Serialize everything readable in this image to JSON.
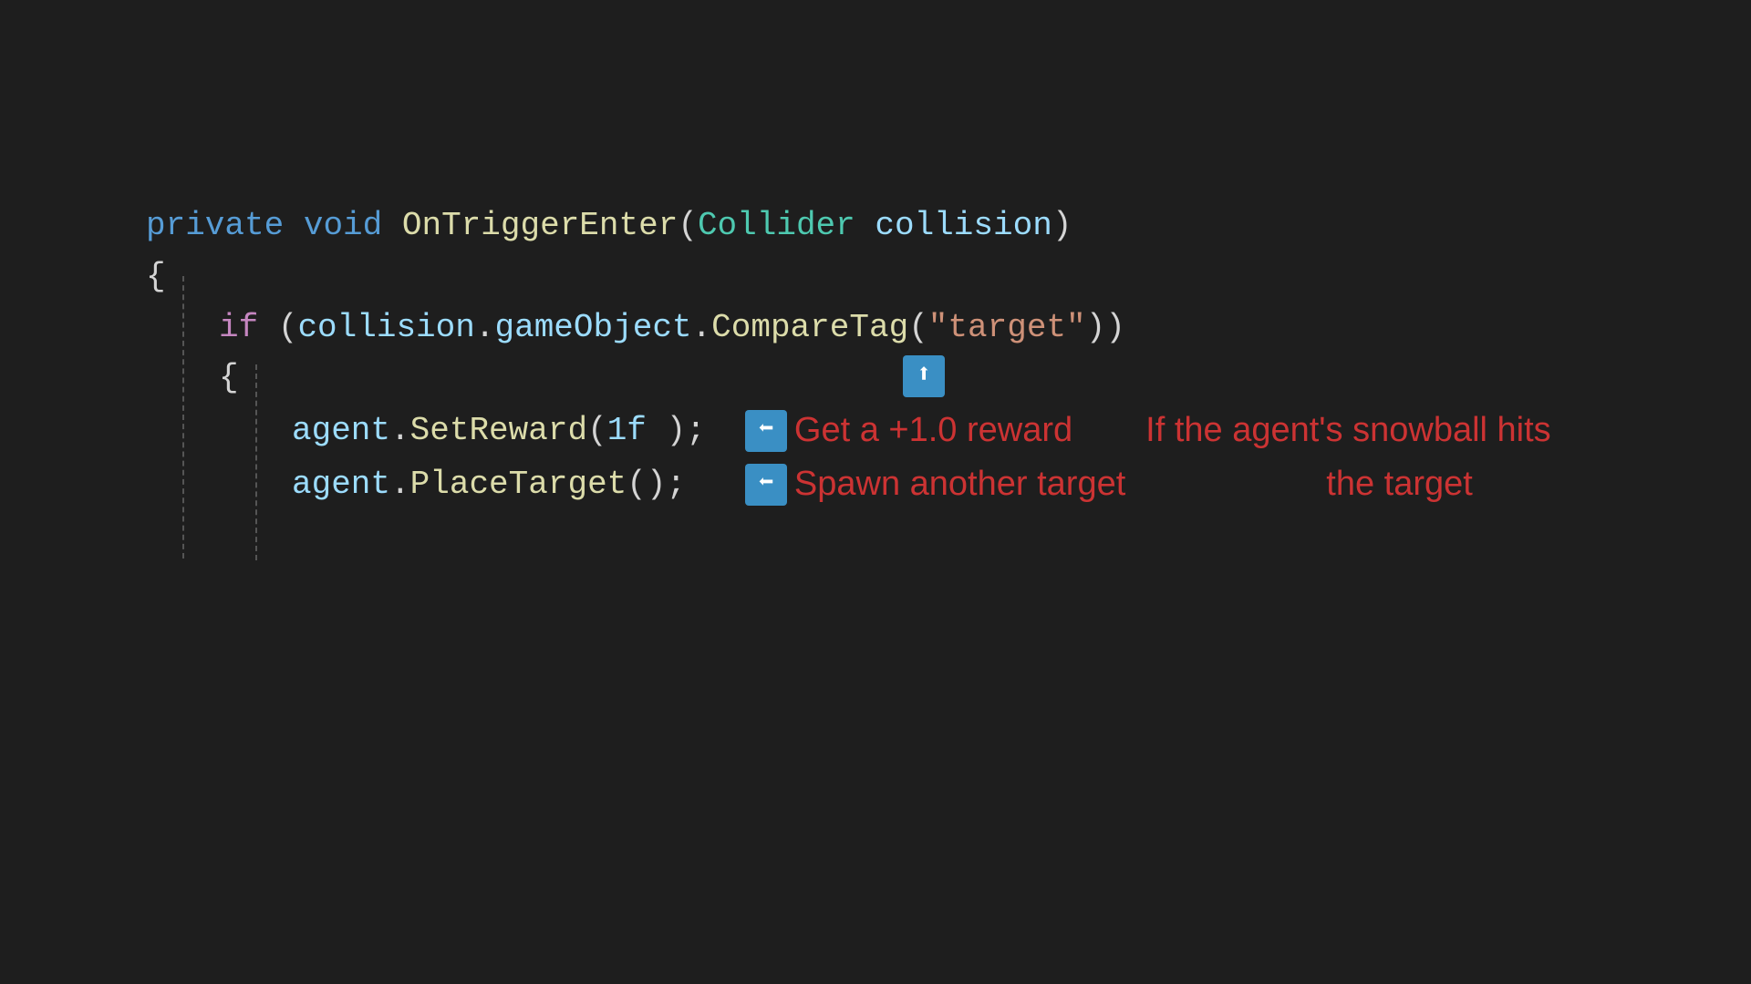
{
  "background": "#1e1e1e",
  "code": {
    "line1": {
      "private": "private",
      "void": "void",
      "methodName": "OnTriggerEnter",
      "param_type": "Collider",
      "param_name": "collision",
      "parens": "()",
      "full": "private void OnTriggerEnter(Collider collision)"
    },
    "line2": {
      "brace_open": "{"
    },
    "line3": {
      "if": "if",
      "condition": "(collision.gameObject.CompareTag(\"target\"))"
    },
    "line4": {
      "brace_open": "    {"
    },
    "line5": {
      "code": "agent.SetReward(1f );"
    },
    "line6": {
      "code": "agent.PlaceTarget();"
    },
    "line7": {
      "brace_close": "    }"
    }
  },
  "annotations": {
    "annotation1": {
      "arrow_symbol": "⬆",
      "line1": "If the agent's snowball hits",
      "line2": "the target"
    },
    "annotation2": {
      "arrow_symbol": "⬅",
      "text": "Get a +1.0 reward"
    },
    "annotation3": {
      "arrow_symbol": "⬅",
      "text": "Spawn another target"
    }
  }
}
